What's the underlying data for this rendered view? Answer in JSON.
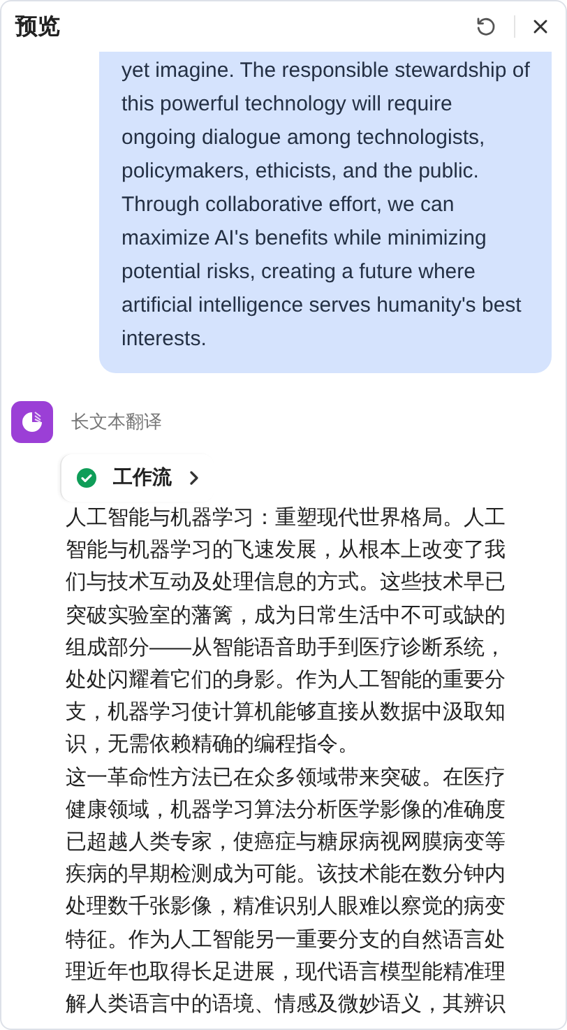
{
  "window": {
    "title": "预览"
  },
  "user_message": {
    "text": "yet imagine. The responsible stewardship of this powerful technology will require ongoing dialogue among technologists, policymakers, ethicists, and the public. Through collaborative effort, we can maximize AI's benefits while minimizing potential risks, creating a future where artificial intelligence serves humanity's best interests."
  },
  "bot": {
    "name": "长文本翻译",
    "workflow": {
      "label": "工作流",
      "done": true
    },
    "paragraphs": [
      "人工智能与机器学习：重塑现代世界格局。人工智能与机器学习的飞速发展，从根本上改变了我们与技术互动及处理信息的方式。这些技术早已突破实验室的藩篱，成为日常生活中不可或缺的组成部分——从智能语音助手到医疗诊断系统，处处闪耀着它们的身影。作为人工智能的重要分支，机器学习使计算机能够直接从数据中汲取知识，无需依赖精确的编程指令。",
      "这一革命性方法已在众多领域带来突破。在医疗健康领域，机器学习算法分析医学影像的准确度已超越人类专家，使癌症与糖尿病视网膜病变等疾病的早期检测成为可能。该技术能在数分钟内处理数千张影像，精准识别人眼难以察觉的病变特征。作为人工智能另一重要分支的自然语言处理近年也取得长足进展，现代语言模型能精准理解人类语言中的语境、情感及微妙语义，其辨识"
    ]
  }
}
